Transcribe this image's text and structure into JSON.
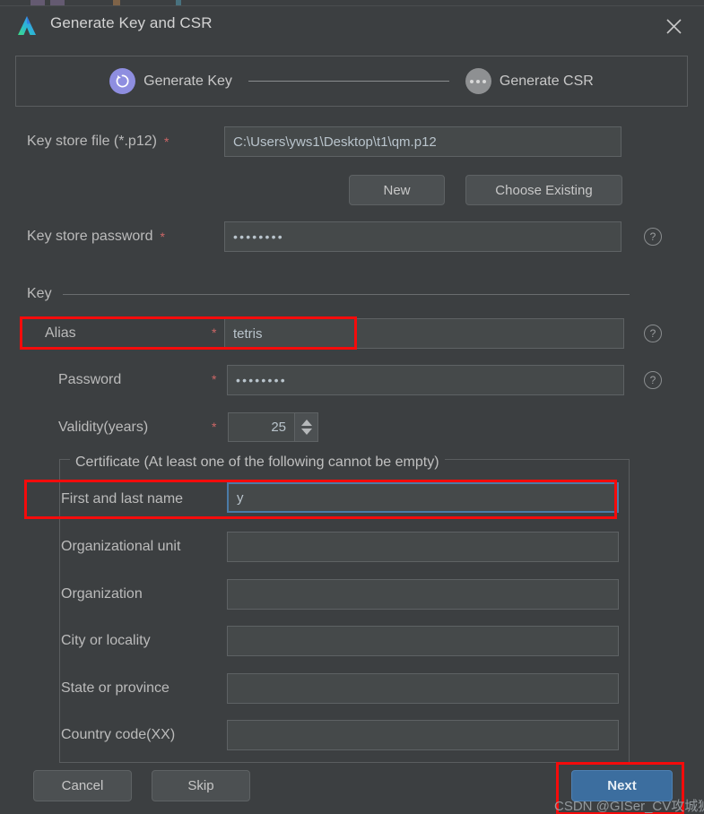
{
  "window": {
    "title": "Generate Key and CSR",
    "logo_icon": "android-studio-logo",
    "close_icon": "close-icon"
  },
  "stepper": {
    "steps": [
      {
        "label": "Generate Key",
        "state": "active",
        "icon": "refresh-spinner-icon"
      },
      {
        "label": "Generate CSR",
        "state": "inactive",
        "icon": "ellipsis-icon"
      }
    ]
  },
  "form": {
    "keystore_file": {
      "label": "Key store file (*.p12)",
      "required_mark": "*",
      "value": "C:\\Users\\yws1\\Desktop\\t1\\qm.p12",
      "placeholder": ""
    },
    "new_button": "New",
    "choose_existing_button": "Choose Existing",
    "keystore_password": {
      "label": "Key store password",
      "required_mark": "*",
      "value": "••••••••",
      "help_icon": "help-icon"
    }
  },
  "key_section": {
    "title": "Key",
    "alias": {
      "label": "Alias",
      "required_mark": "*",
      "value": "tetris",
      "help_icon": "help-icon"
    },
    "password": {
      "label": "Password",
      "required_mark": "*",
      "value": "••••••••",
      "help_icon": "help-icon"
    },
    "validity": {
      "label": "Validity(years)",
      "required_mark": "*",
      "value": "25"
    }
  },
  "certificate_section": {
    "title": "Certificate (At least one of the following cannot be empty)",
    "fields": [
      {
        "label": "First and last name",
        "value": "y",
        "focused": true
      },
      {
        "label": "Organizational unit",
        "value": "",
        "focused": false
      },
      {
        "label": "Organization",
        "value": "",
        "focused": false
      },
      {
        "label": "City or locality",
        "value": "",
        "focused": false
      },
      {
        "label": "State or province",
        "value": "",
        "focused": false
      },
      {
        "label": "Country code(XX)",
        "value": "",
        "focused": false
      }
    ]
  },
  "footer": {
    "cancel_button": "Cancel",
    "skip_button": "Skip",
    "next_button": "Next"
  },
  "watermark": "CSDN @GISer_CV攻城狮",
  "colors": {
    "dialog_bg": "#3c3f41",
    "field_bg": "#45494a",
    "accent_active_step": "#8e8ee0",
    "inactive_step": "#8e9092",
    "primary_button": "#3c6e9f",
    "focus_border": "#4a7ba8",
    "annotation_red": "#f50b0b",
    "required_star": "#cc6666"
  }
}
